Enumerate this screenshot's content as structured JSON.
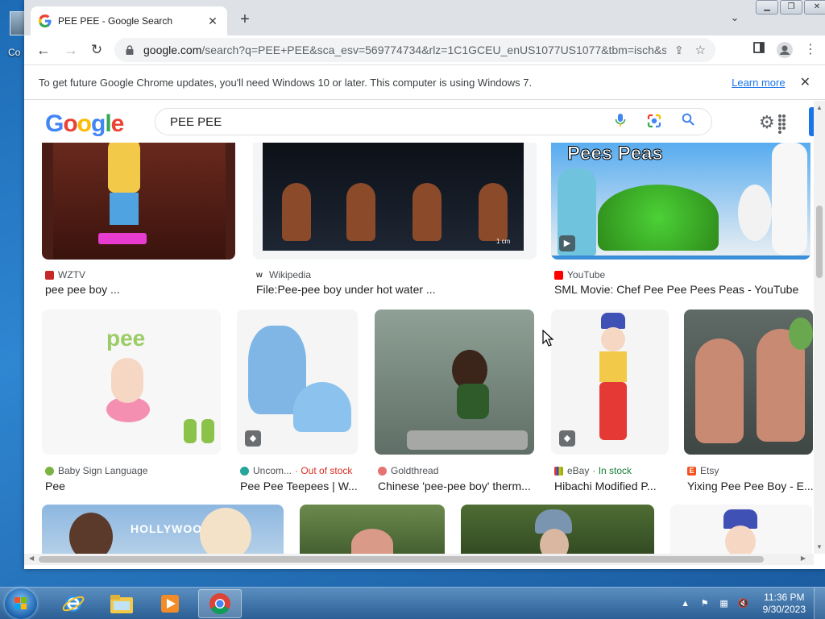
{
  "desktop": {
    "icon_label": "Co"
  },
  "browser": {
    "tab_title": "PEE PEE - Google Search",
    "url_host": "google.com",
    "url_rest": "/search?q=PEE+PEE&sca_esv=569774734&rlz=1C1GCEU_enUS1077US1077&tbm=isch&source...",
    "infobar_message": "To get future Google Chrome updates, you'll need Windows 10 or later. This computer is using Windows 7.",
    "infobar_link": "Learn more"
  },
  "google": {
    "logo_text": "Google",
    "search_query": "PEE PEE"
  },
  "results": [
    {
      "source": "WZTV",
      "caption": "pee pee boy ...",
      "stock": "",
      "accent": "#c62828"
    },
    {
      "source": "Wikipedia",
      "caption": "File:Pee-pee boy under hot water ...",
      "stock": "",
      "accent": "#444444"
    },
    {
      "source": "YouTube",
      "caption": "SML Movie: Chef Pee Pee Pees Peas - YouTube",
      "stock": "",
      "accent": "#ff0000",
      "overlay_text": "Pees Peas"
    },
    {
      "source": "Baby Sign Language",
      "caption": "Pee",
      "stock": "",
      "accent": "#7cb342",
      "overlay_text": "pee"
    },
    {
      "source": "Uncom...",
      "caption": "Pee Pee Teepees | W...",
      "stock": "· Out of stock",
      "accent": "#26a69a"
    },
    {
      "source": "Goldthread",
      "caption": "Chinese 'pee-pee boy' therm...",
      "stock": "",
      "accent": "#e57373"
    },
    {
      "source": "eBay",
      "caption": "Hibachi Modified P...",
      "stock": "· In stock",
      "accent": "#1565c0"
    },
    {
      "source": "Etsy",
      "caption": "Yixing Pee Pee Boy - E...",
      "stock": "",
      "accent": "#f4511e"
    },
    {
      "source": "",
      "caption": "",
      "stock": "",
      "accent": "#000000",
      "overlay_text": "HOLLYWOOD"
    }
  ],
  "thumb_badge_scale": "1 cm",
  "taskbar": {
    "time": "11:36 PM",
    "date": "9/30/2023"
  }
}
